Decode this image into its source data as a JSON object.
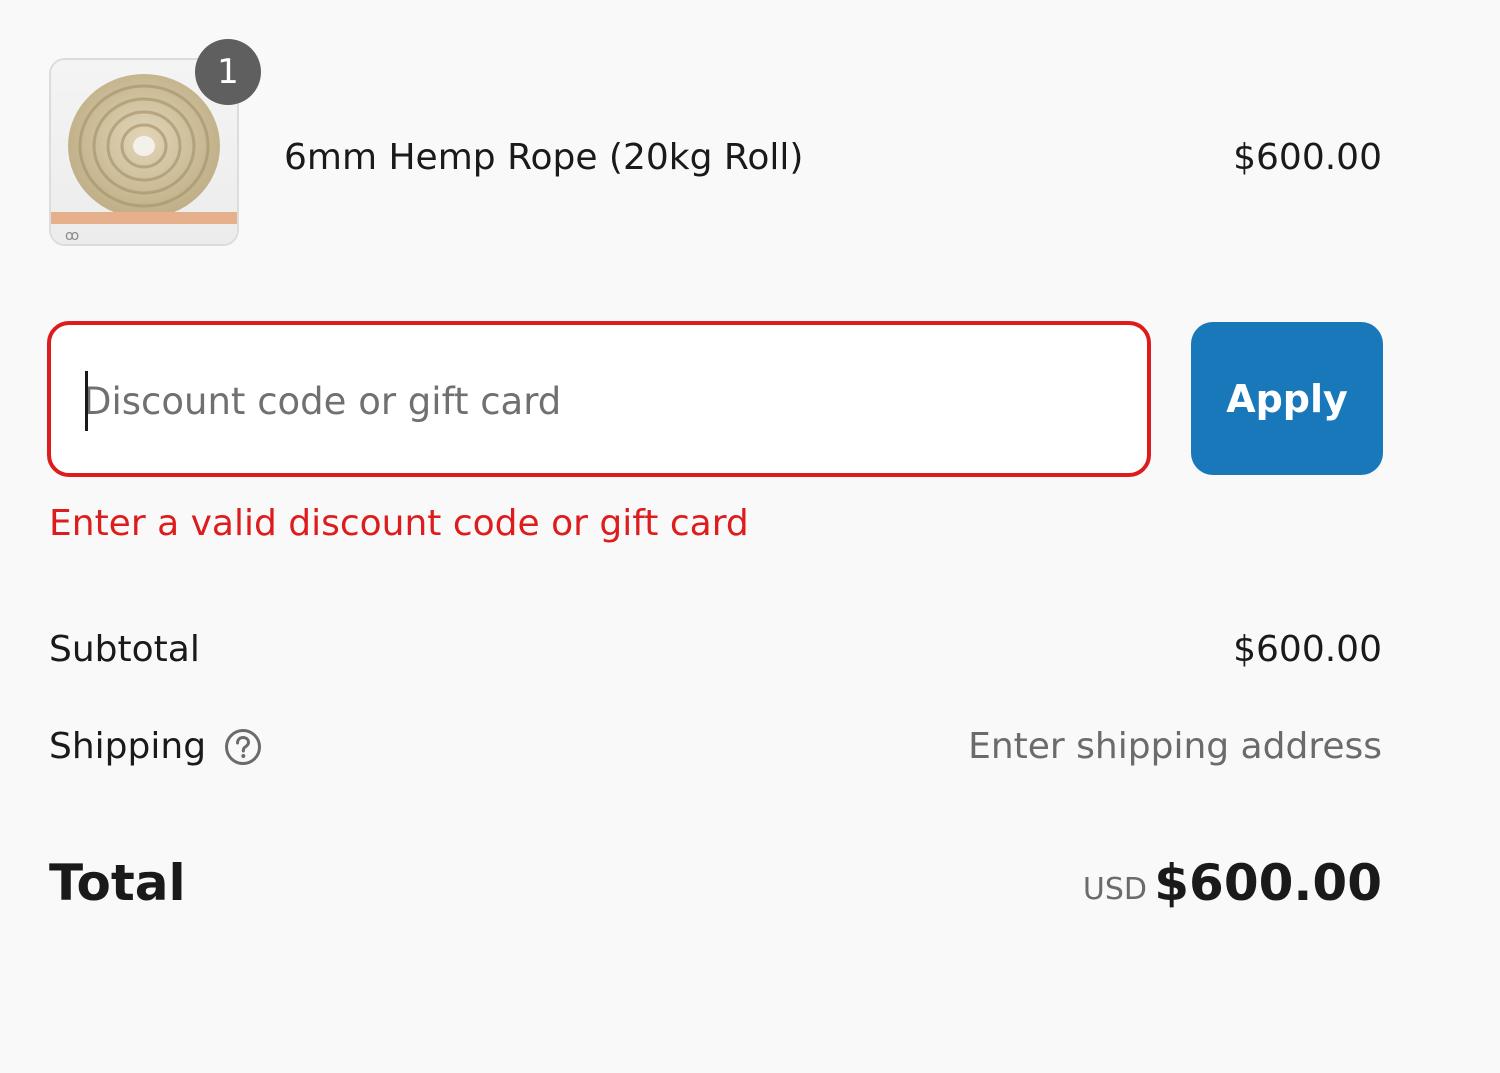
{
  "line_item": {
    "quantity": "1",
    "name": "6mm Hemp Rope (20kg Roll)",
    "price": "$600.00",
    "image_icon": "rope-roll-image"
  },
  "discount": {
    "placeholder": "Discount code or gift card",
    "value": "",
    "apply_label": "Apply",
    "error": "Enter a valid discount code or gift card"
  },
  "summary": {
    "subtotal_label": "Subtotal",
    "subtotal_value": "$600.00",
    "shipping_label": "Shipping",
    "shipping_value": "Enter shipping address",
    "help_icon": "question-circle-icon",
    "total_label": "Total",
    "currency": "USD",
    "total_value": "$600.00"
  },
  "colors": {
    "error": "#dd1d1d",
    "accent": "#1878b9",
    "badge": "#5f5f5f"
  }
}
